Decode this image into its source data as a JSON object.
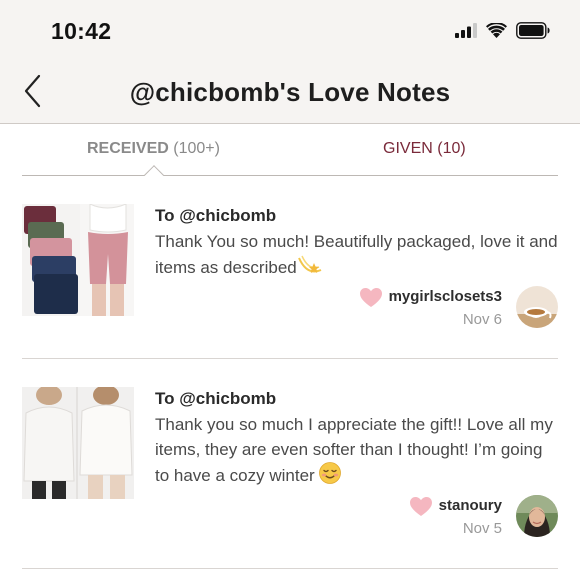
{
  "status_bar": {
    "time": "10:42"
  },
  "nav": {
    "title": "@chicbomb's Love Notes"
  },
  "tabs": {
    "received_label": "RECEIVED",
    "received_count": "(100+)",
    "given_label": "GIVEN (10)"
  },
  "notes": [
    {
      "to": "To @chicbomb",
      "message": "Thank You so much! Beautifully packaged, love it and items as described",
      "emoji": "dizzy-star",
      "sender": "mygirlsclosets3",
      "date": "Nov 6"
    },
    {
      "to": "To @chicbomb",
      "message": "Thank you so much I appreciate the gift!! Love all my items, they are even softer than I thought! I’m going to have a cozy winter",
      "emoji": "smiling-face",
      "sender": "stanoury",
      "date": "Nov 5"
    }
  ],
  "colors": {
    "header_bg": "#f6f4f2",
    "given_tab": "#7a2a3a",
    "heart": "#f5b7c0"
  }
}
